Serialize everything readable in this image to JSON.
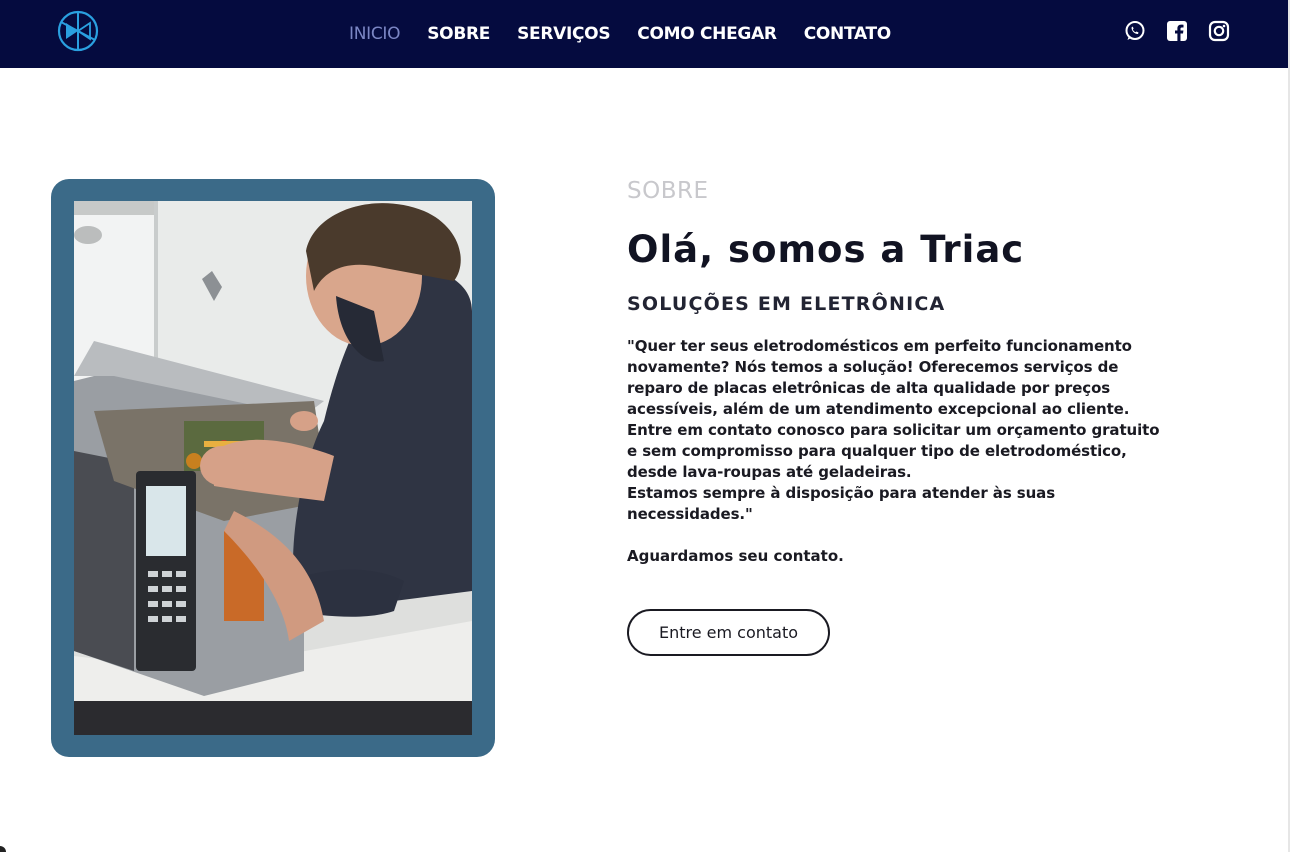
{
  "nav": {
    "logo_icon": "triac-logo-icon",
    "links": [
      {
        "label": "INICIO",
        "active": true
      },
      {
        "label": "SOBRE"
      },
      {
        "label": "SERVIÇOS"
      },
      {
        "label": "COMO CHEGAR"
      },
      {
        "label": "CONTATO"
      }
    ],
    "social_icons": [
      "whatsapp-icon",
      "facebook-icon",
      "instagram-icon"
    ]
  },
  "colors": {
    "navbar_bg": "#050b3f",
    "active_link": "#7b86c4",
    "photo_frame": "#3b6a88"
  },
  "about": {
    "eyebrow": "SOBRE",
    "heading": "Olá, somos a Triac",
    "subheading": "SOLUÇÕES EM ELETRÔNICA",
    "paragraph": "\"Quer ter seus eletrodomésticos em perfeito funcionamento\nnovamente? Nós temos a solução! Oferecemos serviços de\nreparo de placas eletrônicas de alta qualidade por preços\nacessíveis, além de um atendimento excepcional ao cliente.\nEntre em contato conosco para solicitar um orçamento gratuito\ne sem compromisso para qualquer tipo de eletrodoméstico,\ndesde lava-roupas até geladeiras.\nEstamos sempre à disposição para atender às suas\nnecessidades.\"",
    "closing": "Aguardamos seu contato.",
    "cta_label": "Entre em contato"
  },
  "photo": {
    "subject": "technician-repairing-microwave-image"
  }
}
